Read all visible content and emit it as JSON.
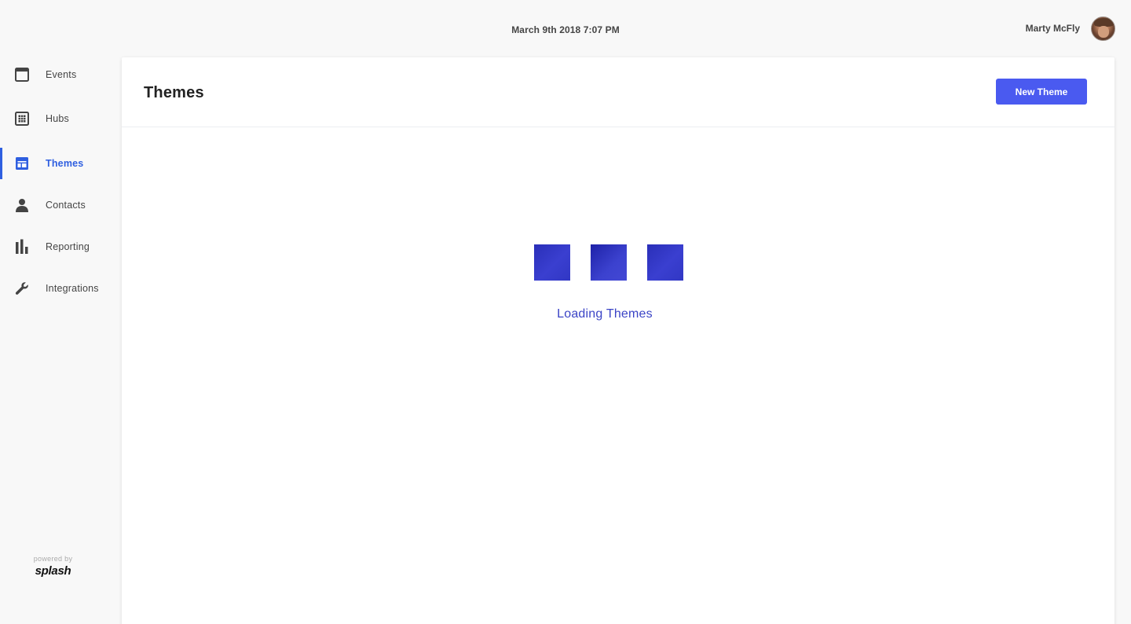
{
  "header": {
    "datetime": "March 9th 2018 7:07 PM",
    "user_name": "Marty McFly"
  },
  "sidebar": {
    "items": [
      {
        "label": "Events",
        "icon": "calendar-icon",
        "active": false
      },
      {
        "label": "Hubs",
        "icon": "grid-icon",
        "active": false
      },
      {
        "label": "Themes",
        "icon": "layout-icon",
        "active": true
      },
      {
        "label": "Contacts",
        "icon": "person-icon",
        "active": false
      },
      {
        "label": "Reporting",
        "icon": "bar-chart-icon",
        "active": false
      },
      {
        "label": "Integrations",
        "icon": "wrench-icon",
        "active": false
      }
    ],
    "powered_by": "powered by",
    "brand": "splash"
  },
  "main": {
    "title": "Themes",
    "new_button_label": "New Theme",
    "loading_text": "Loading Themes"
  },
  "colors": {
    "accent": "#2f5fe0",
    "button": "#4a5af0",
    "loader": "#3137c4"
  }
}
